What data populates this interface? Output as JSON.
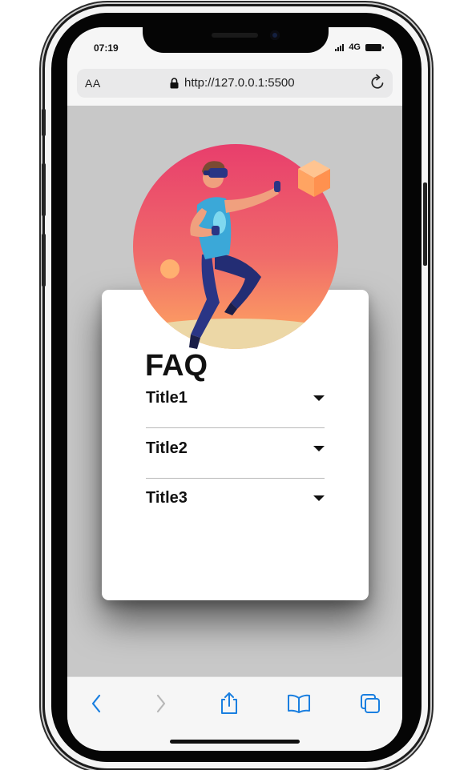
{
  "status_bar": {
    "time": "07:19",
    "network": "4G",
    "icons": [
      "signal-icon",
      "battery-icon"
    ]
  },
  "url_bar": {
    "text_size_label": "AA",
    "url": "http://127.0.0.1:5500",
    "icons": [
      "lock-icon",
      "reload-icon"
    ]
  },
  "faq": {
    "title": "FAQ",
    "items": [
      {
        "title": "Title1",
        "expanded": false
      },
      {
        "title": "Title2",
        "expanded": false
      },
      {
        "title": "Title3",
        "expanded": false
      }
    ],
    "icon": "chevron-down-icon"
  },
  "hero": {
    "icon": "vr-person-illustration",
    "colors": {
      "circle_top": "#E83E6C",
      "circle_bottom": "#FFAA60",
      "shirt": "#3BA8D8",
      "pants": "#27307A"
    }
  },
  "toolbar": {
    "items": [
      "back-icon",
      "forward-icon",
      "share-icon",
      "bookmarks-icon",
      "tabs-icon"
    ],
    "forward_enabled": false,
    "accent_color": "#1A7FE0"
  },
  "colors": {
    "page_background": "#C8C8C8",
    "card_background": "#FFFFFF",
    "text": "#111111"
  }
}
